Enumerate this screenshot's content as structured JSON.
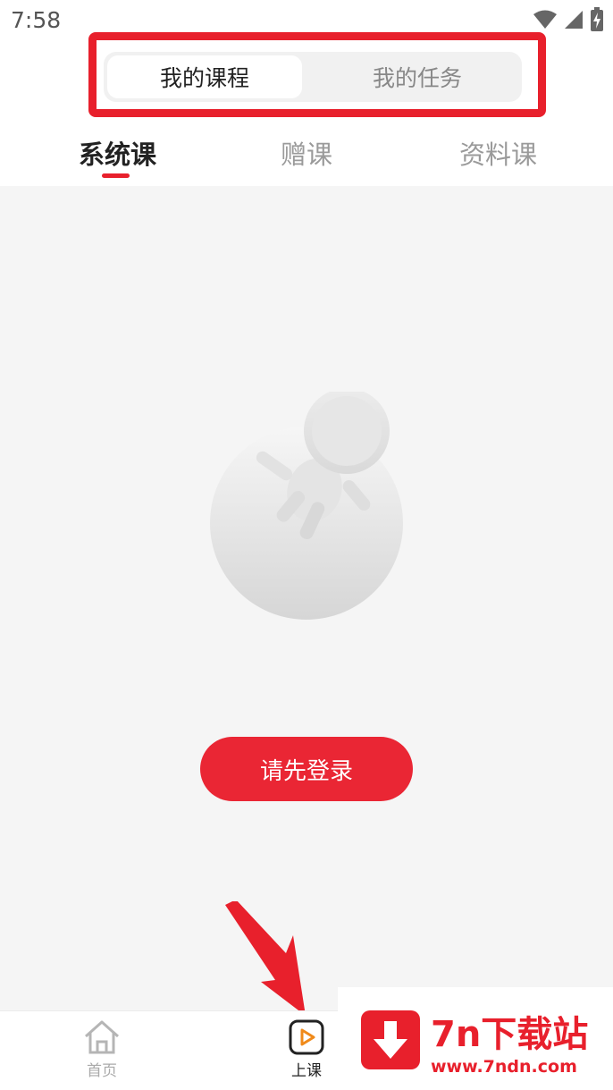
{
  "status_bar": {
    "time": "7:58",
    "icons": [
      "wifi-icon",
      "signal-icon",
      "battery-charging-icon"
    ]
  },
  "segment": {
    "items": [
      {
        "label": "我的课程",
        "active": true
      },
      {
        "label": "我的任务",
        "active": false
      }
    ]
  },
  "tabs": {
    "items": [
      {
        "label": "系统课",
        "active": true
      },
      {
        "label": "赠课",
        "active": false
      },
      {
        "label": "资料课",
        "active": false
      }
    ]
  },
  "empty_state": {
    "illustration": "astronaut-planet-illustration",
    "login_label": "请先登录"
  },
  "bottom_nav": {
    "items": [
      {
        "label": "首页",
        "icon": "home-icon",
        "active": false
      },
      {
        "label": "上课",
        "icon": "play-class-icon",
        "active": true
      }
    ]
  },
  "watermark": {
    "title": "7n下载站",
    "url": "www.7ndn.com"
  },
  "colors": {
    "accent": "#e8202c",
    "button": "#ea2634",
    "background": "#f5f5f5"
  }
}
